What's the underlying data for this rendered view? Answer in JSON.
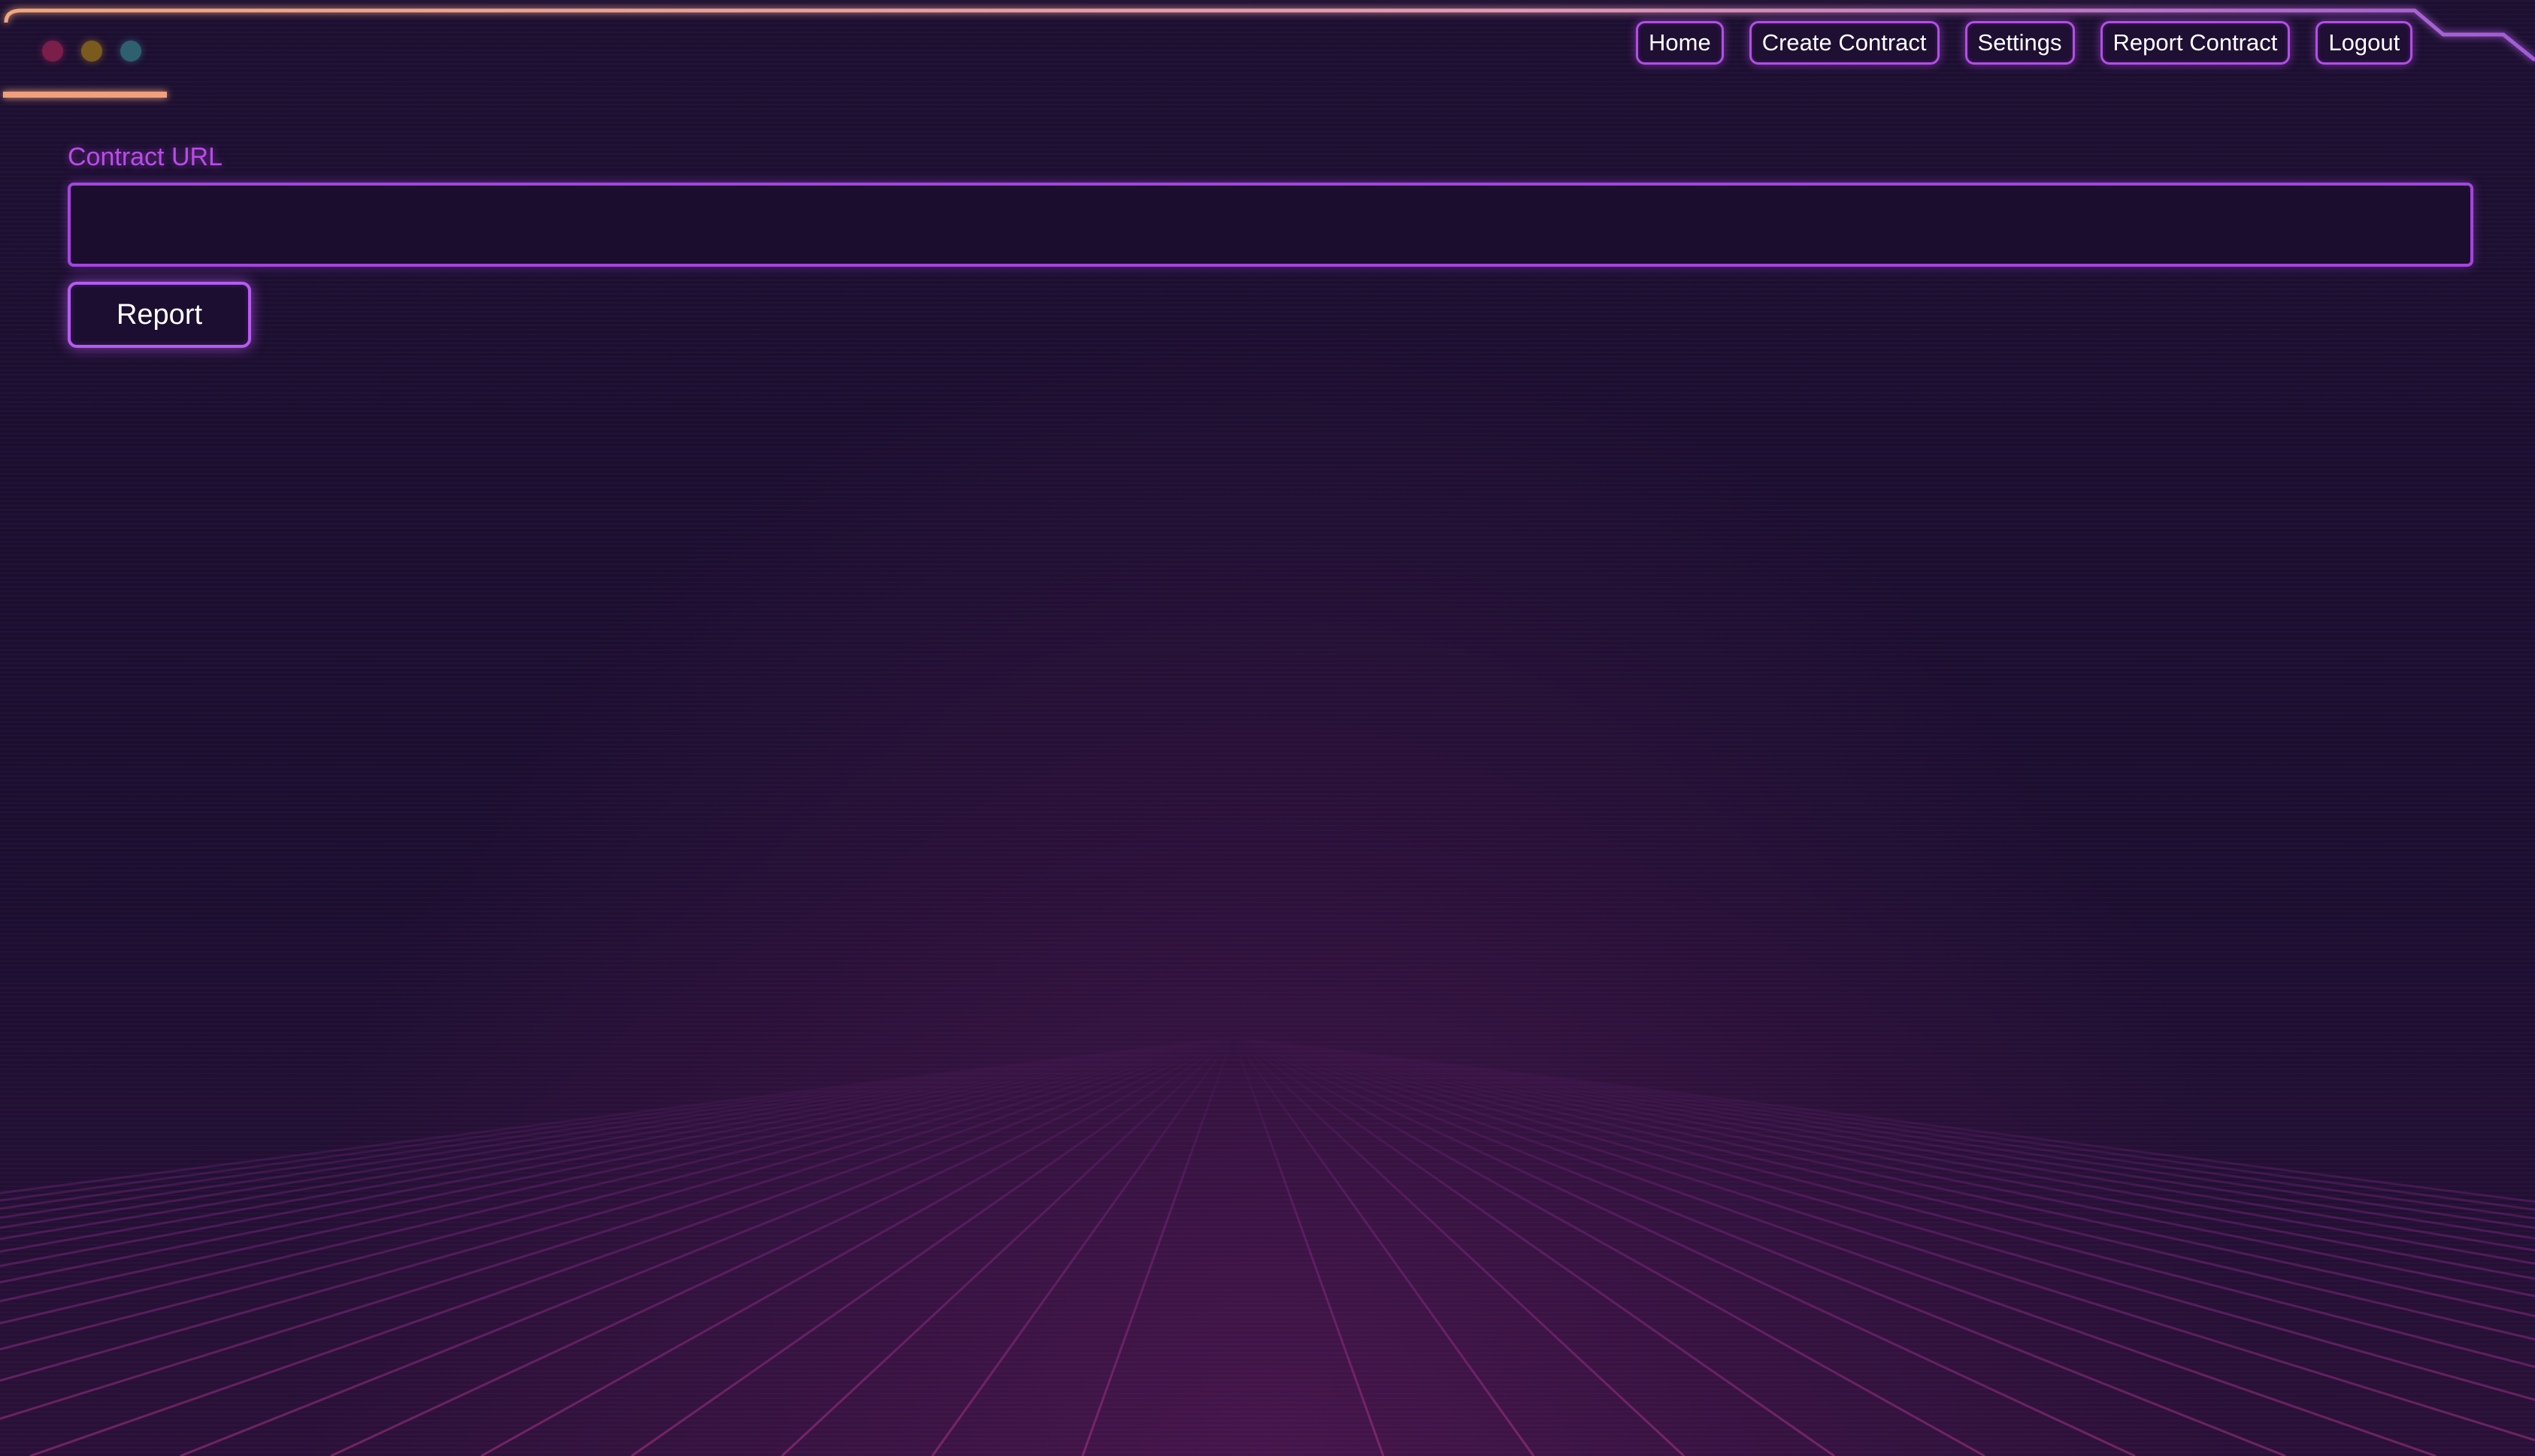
{
  "window": {
    "controls": [
      "close-dot",
      "minimize-dot",
      "maximize-dot"
    ]
  },
  "nav": {
    "items": [
      {
        "label": "Home"
      },
      {
        "label": "Create Contract"
      },
      {
        "label": "Settings"
      },
      {
        "label": "Report Contract"
      },
      {
        "label": "Logout"
      }
    ]
  },
  "form": {
    "url_label": "Contract URL",
    "url_value": "",
    "url_placeholder": "",
    "submit_label": "Report"
  },
  "colors": {
    "background": "#1c0e30",
    "accent_purple": "#b34ee6",
    "frame_orange": "#f0a07a",
    "label_purple": "#b94ce8"
  }
}
